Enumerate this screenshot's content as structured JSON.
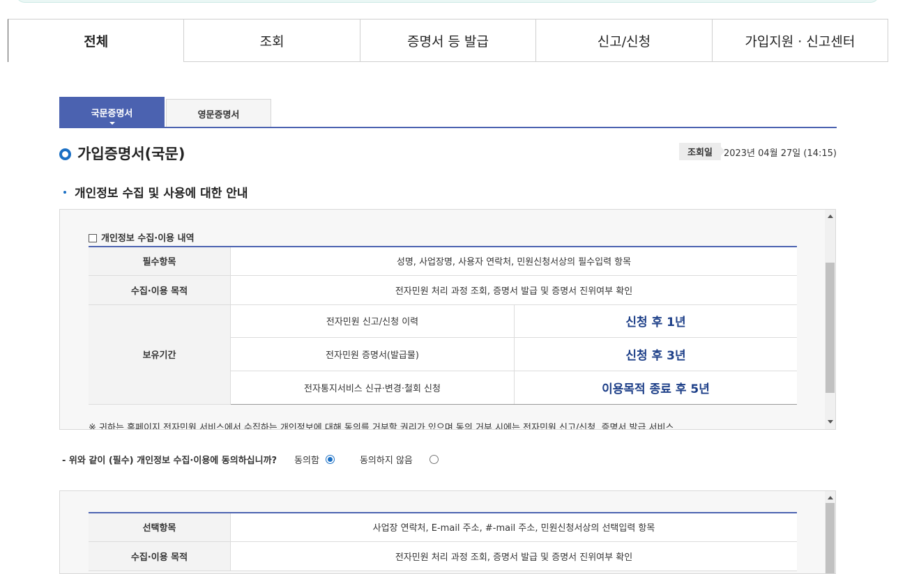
{
  "main_tabs": [
    {
      "label": "전체",
      "active": true
    },
    {
      "label": "조회",
      "active": false
    },
    {
      "label": "증명서 등 발급",
      "active": false
    },
    {
      "label": "신고/신청",
      "active": false
    },
    {
      "label": "가입지원 · 신고센터",
      "active": false
    }
  ],
  "sub_tabs": [
    {
      "label": "국문증명서",
      "active": true
    },
    {
      "label": "영문증명서",
      "active": false
    }
  ],
  "page_title": "가입증명서(국문)",
  "date": {
    "label": "조회일",
    "value": "2023년 04월 27일 (14:15)"
  },
  "section_heading": "개인정보 수집 및 사용에 대한 안내",
  "required_box": {
    "subtitle": "개인정보 수집·이용 내역",
    "rows": [
      {
        "header": "필수항목",
        "value": "성명, 사업장명, 사용자 연락처, 민원신청서상의 필수입력 항목"
      },
      {
        "header": "수집·이용 목적",
        "value": "전자민원 처리 과정 조회, 증명서 발급 및 증명서 진위여부 확인"
      }
    ],
    "retention": {
      "header": "보유기간",
      "items": [
        {
          "item": "전자민원 신고/신청 이력",
          "period": "신청 후 1년"
        },
        {
          "item": "전자민원 증명서(발급물)",
          "period": "신청 후 3년"
        },
        {
          "item": "전자통지서비스 신규·변경·철회 신청",
          "period": "이용목적 종료 후 5년"
        }
      ]
    },
    "note": "※ 귀하는 홈페이지 전자민원 서비스에서 수집하는 개인정보에 대해 동의를 거부할 권리가 있으며 동의 거부 시에는 전자민원 신고/신청, 증명서 발급 서비스"
  },
  "consent": {
    "question": "- 위와 같이 (필수) 개인정보 수집·이용에 동의하십니까?",
    "agree_label": "동의함",
    "disagree_label": "동의하지 않음",
    "selected": "agree"
  },
  "optional_box": {
    "rows": [
      {
        "header": "선택항목",
        "value": "사업장 연락처, E-mail 주소, #-mail 주소, 민원신청서상의 선택입력 항목"
      },
      {
        "header": "수집·이용 목적",
        "value": "전자민원 처리 과정 조회, 증명서 발급 및 증명서 진위여부 확인"
      }
    ]
  },
  "colors": {
    "accent": "#4b62b0",
    "highlight": "#1d3f88",
    "ring": "#1a6fc4"
  }
}
